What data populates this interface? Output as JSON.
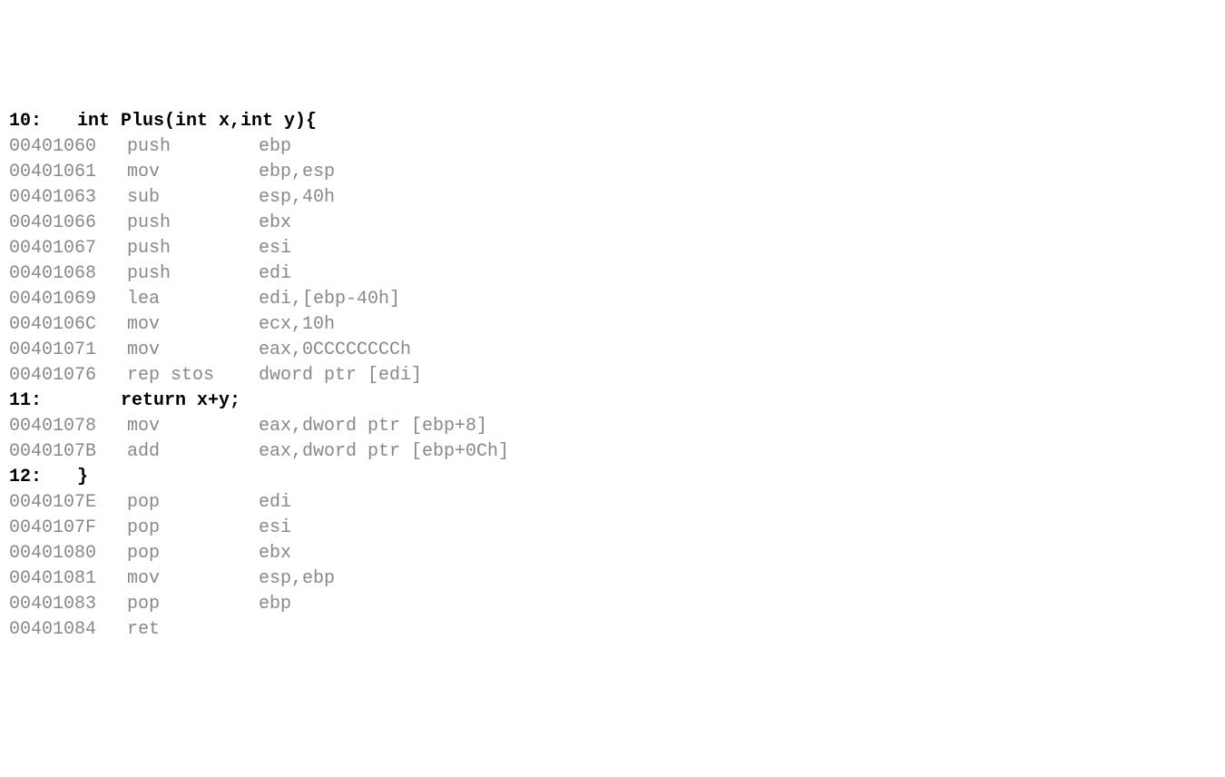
{
  "lines": [
    {
      "type": "source",
      "num": "10:",
      "code": "int Plus(int x,int y){"
    },
    {
      "type": "asm",
      "addr": "00401060",
      "mnemonic": "push",
      "operand": "ebp"
    },
    {
      "type": "asm",
      "addr": "00401061",
      "mnemonic": "mov",
      "operand": "ebp,esp"
    },
    {
      "type": "asm",
      "addr": "00401063",
      "mnemonic": "sub",
      "operand": "esp,40h"
    },
    {
      "type": "asm",
      "addr": "00401066",
      "mnemonic": "push",
      "operand": "ebx"
    },
    {
      "type": "asm",
      "addr": "00401067",
      "mnemonic": "push",
      "operand": "esi"
    },
    {
      "type": "asm",
      "addr": "00401068",
      "mnemonic": "push",
      "operand": "edi"
    },
    {
      "type": "asm",
      "addr": "00401069",
      "mnemonic": "lea",
      "operand": "edi,[ebp-40h]"
    },
    {
      "type": "asm",
      "addr": "0040106C",
      "mnemonic": "mov",
      "operand": "ecx,10h"
    },
    {
      "type": "asm",
      "addr": "00401071",
      "mnemonic": "mov",
      "operand": "eax,0CCCCCCCCh"
    },
    {
      "type": "asm",
      "addr": "00401076",
      "mnemonic": "rep stos",
      "operand": "dword ptr [edi]"
    },
    {
      "type": "source",
      "num": "11:",
      "code": "    return x+y;"
    },
    {
      "type": "asm",
      "addr": "00401078",
      "mnemonic": "mov",
      "operand": "eax,dword ptr [ebp+8]"
    },
    {
      "type": "asm",
      "addr": "0040107B",
      "mnemonic": "add",
      "operand": "eax,dword ptr [ebp+0Ch]"
    },
    {
      "type": "source",
      "num": "12:",
      "code": "}"
    },
    {
      "type": "asm",
      "addr": "0040107E",
      "mnemonic": "pop",
      "operand": "edi"
    },
    {
      "type": "asm",
      "addr": "0040107F",
      "mnemonic": "pop",
      "operand": "esi"
    },
    {
      "type": "asm",
      "addr": "00401080",
      "mnemonic": "pop",
      "operand": "ebx"
    },
    {
      "type": "asm",
      "addr": "00401081",
      "mnemonic": "mov",
      "operand": "esp,ebp"
    },
    {
      "type": "asm",
      "addr": "00401083",
      "mnemonic": "pop",
      "operand": "ebp"
    },
    {
      "type": "asm",
      "addr": "00401084",
      "mnemonic": "ret",
      "operand": ""
    }
  ]
}
